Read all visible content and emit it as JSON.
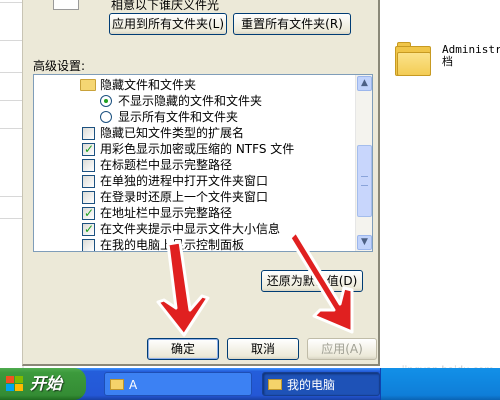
{
  "dialog": {
    "top_caption": "相意以下谁庆义件光",
    "apply_all_button": "应用到所有文件夹(L)",
    "reset_all_button": "重置所有文件夹(R)",
    "advanced_label": "高级设置:",
    "tree_items": [
      {
        "type": "folder",
        "label": "隐藏文件和文件夹"
      },
      {
        "type": "radio",
        "checked": true,
        "label": "不显示隐藏的文件和文件夹"
      },
      {
        "type": "radio",
        "checked": false,
        "label": "显示所有文件和文件夹"
      },
      {
        "type": "checkbox",
        "checked": false,
        "label": "隐藏已知文件类型的扩展名"
      },
      {
        "type": "checkbox",
        "checked": true,
        "label": "用彩色显示加密或压缩的 NTFS 文件"
      },
      {
        "type": "checkbox",
        "checked": false,
        "label": "在标题栏中显示完整路径"
      },
      {
        "type": "checkbox",
        "checked": false,
        "label": "在单独的进程中打开文件夹窗口"
      },
      {
        "type": "checkbox",
        "checked": false,
        "label": "在登录时还原上一个文件夹窗口"
      },
      {
        "type": "checkbox",
        "checked": true,
        "label": "在地址栏中显示完整路径"
      },
      {
        "type": "checkbox",
        "checked": true,
        "label": "在文件夹提示中显示文件大小信息"
      },
      {
        "type": "checkbox",
        "checked": false,
        "label": "在我的电脑上显示控制面板"
      }
    ],
    "restore_defaults_button": "还原为默认值(D)",
    "ok_button": "确定",
    "cancel_button": "取消",
    "apply_button": "应用(A)"
  },
  "explorer": {
    "folder_label": "Administra\n档"
  },
  "taskbar": {
    "start_label": "开始",
    "tasks": [
      {
        "label": "A",
        "active": false
      },
      {
        "label": "我的电脑",
        "active": true
      }
    ]
  },
  "watermark": "jingyan.baidu.com",
  "colors": {
    "dialog_bg": "#ece9d8",
    "taskbar_blue": "#245edb",
    "start_green": "#3c9a3c",
    "arrow_red": "#e02020"
  }
}
